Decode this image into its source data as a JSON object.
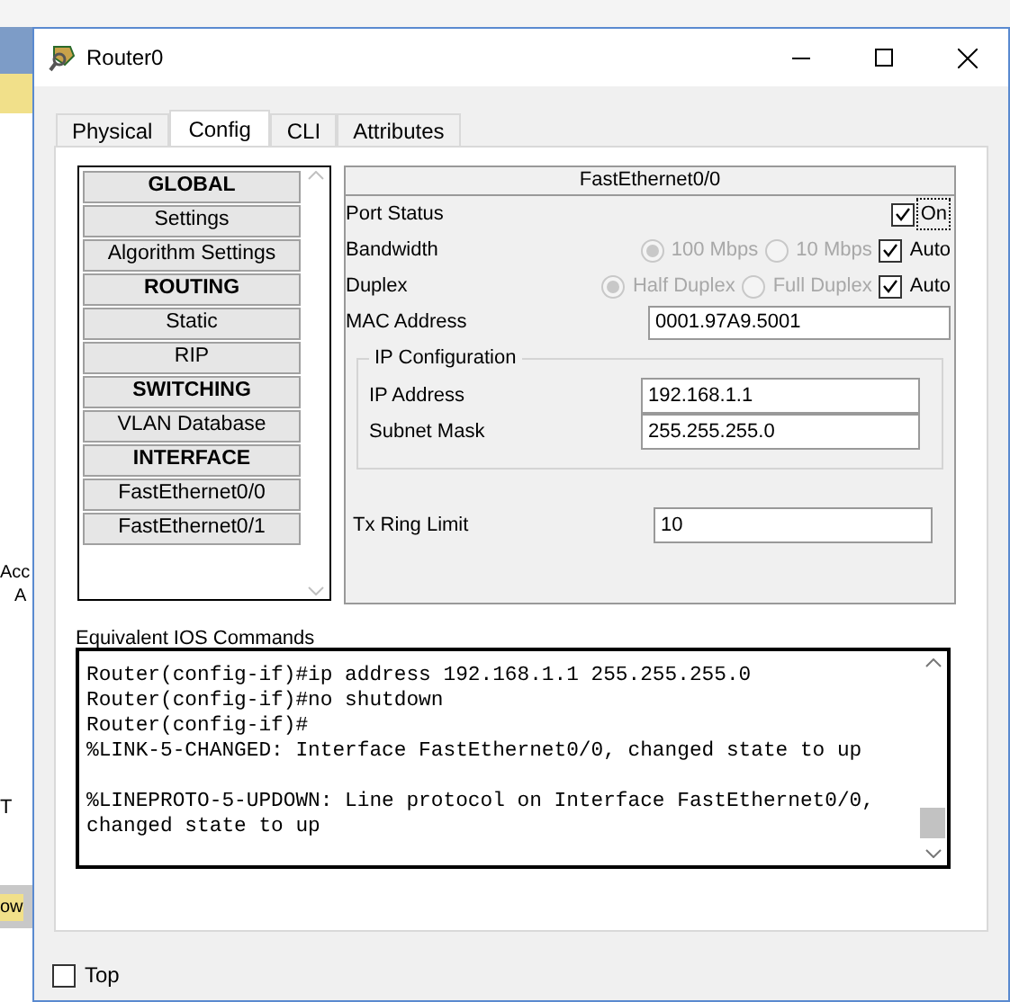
{
  "background": {
    "fragments": [
      "Acc",
      "A",
      "T",
      "ow"
    ]
  },
  "window": {
    "title": "Router0"
  },
  "tabs": [
    {
      "label": "Physical",
      "selected": false
    },
    {
      "label": "Config",
      "selected": true
    },
    {
      "label": "CLI",
      "selected": false
    },
    {
      "label": "Attributes",
      "selected": false
    }
  ],
  "sidebar": {
    "items": [
      {
        "label": "GLOBAL",
        "kind": "header"
      },
      {
        "label": "Settings",
        "kind": "item"
      },
      {
        "label": "Algorithm Settings",
        "kind": "item"
      },
      {
        "label": "ROUTING",
        "kind": "header"
      },
      {
        "label": "Static",
        "kind": "item"
      },
      {
        "label": "RIP",
        "kind": "item"
      },
      {
        "label": "SWITCHING",
        "kind": "header"
      },
      {
        "label": "VLAN Database",
        "kind": "item"
      },
      {
        "label": "INTERFACE",
        "kind": "header"
      },
      {
        "label": "FastEthernet0/0",
        "kind": "item"
      },
      {
        "label": "FastEthernet0/1",
        "kind": "item"
      }
    ]
  },
  "interface_panel": {
    "title": "FastEthernet0/0",
    "port_status": {
      "label": "Port Status",
      "option": "On",
      "checked": true
    },
    "bandwidth": {
      "label": "Bandwidth",
      "options": [
        {
          "label": "100 Mbps",
          "selected": true
        },
        {
          "label": "10 Mbps",
          "selected": false
        }
      ],
      "disabled": true,
      "auto": {
        "label": "Auto",
        "checked": true
      }
    },
    "duplex": {
      "label": "Duplex",
      "options": [
        {
          "label": "Half Duplex",
          "selected": true
        },
        {
          "label": "Full Duplex",
          "selected": false
        }
      ],
      "disabled": true,
      "auto": {
        "label": "Auto",
        "checked": true
      }
    },
    "mac_address": {
      "label": "MAC Address",
      "value": "0001.97A9.5001"
    },
    "ip_configuration": {
      "title": "IP Configuration",
      "ip_address": {
        "label": "IP Address",
        "value": "192.168.1.1"
      },
      "subnet_mask": {
        "label": "Subnet Mask",
        "value": "255.255.255.0"
      }
    },
    "tx_ring_limit": {
      "label": "Tx Ring Limit",
      "value": "10"
    }
  },
  "commands": {
    "label": "Equivalent IOS Commands",
    "lines": [
      {
        "text": "Router(config-if)#ip address 192.168.1.1 255.255.255.0",
        "blank_before": false
      },
      {
        "text": "Router(config-if)#no shutdown",
        "blank_before": false
      },
      {
        "text": "Router(config-if)#",
        "blank_before": false
      },
      {
        "text": "%LINK-5-CHANGED: Interface FastEthernet0/0, changed state to up",
        "blank_before": false
      },
      {
        "text": "%LINEPROTO-5-UPDOWN: Line protocol on Interface FastEthernet0/0,",
        "blank_before": true
      },
      {
        "text": "changed state to up",
        "blank_before": false
      }
    ]
  },
  "top_checkbox": {
    "label": "Top",
    "checked": false
  }
}
